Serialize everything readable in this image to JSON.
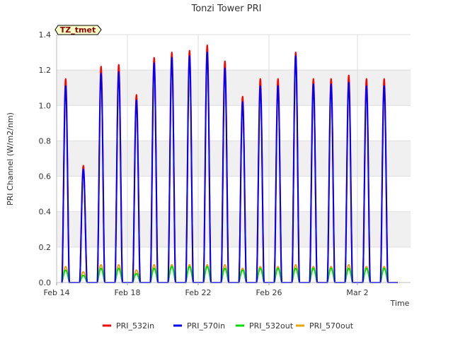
{
  "chart_data": {
    "type": "line",
    "title": "Tonzi Tower PRI",
    "xlabel": "Time",
    "ylabel": "PRI Channel (W/m2/nm)",
    "badge": "TZ_tmet",
    "x_start": "2024-02-14",
    "x_end": "2024-03-05",
    "xticks": [
      "Feb 14",
      "Feb 18",
      "Feb 22",
      "Feb 26",
      "Mar 2"
    ],
    "ylim": [
      0,
      1.4
    ],
    "yticks": [
      "0.0",
      "0.2",
      "0.4",
      "0.6",
      "0.8",
      "1.0",
      "1.2",
      "1.4"
    ],
    "grid": true,
    "legend_position": "bottom",
    "days": [
      "2024-02-14",
      "2024-02-15",
      "2024-02-16",
      "2024-02-17",
      "2024-02-18",
      "2024-02-19",
      "2024-02-20",
      "2024-02-21",
      "2024-02-22",
      "2024-02-23",
      "2024-02-24",
      "2024-02-25",
      "2024-02-26",
      "2024-02-27",
      "2024-02-28",
      "2024-02-29",
      "2024-03-01",
      "2024-03-02",
      "2024-03-03"
    ],
    "series": [
      {
        "name": "PRI_532in",
        "color": "#ff0000",
        "daily_peaks": [
          1.15,
          0.66,
          1.22,
          1.23,
          1.06,
          1.27,
          1.3,
          1.31,
          1.34,
          1.25,
          1.05,
          1.15,
          1.15,
          1.3,
          1.15,
          1.15,
          1.17,
          1.15,
          1.15
        ]
      },
      {
        "name": "PRI_570in",
        "color": "#0000ff",
        "daily_peaks": [
          1.11,
          0.64,
          1.18,
          1.19,
          1.03,
          1.24,
          1.27,
          1.28,
          1.3,
          1.21,
          1.02,
          1.11,
          1.11,
          1.28,
          1.12,
          1.12,
          1.13,
          1.11,
          1.11
        ]
      },
      {
        "name": "PRI_532out",
        "color": "#00dd00",
        "daily_peaks": [
          0.07,
          0.04,
          0.08,
          0.08,
          0.05,
          0.08,
          0.09,
          0.09,
          0.09,
          0.08,
          0.07,
          0.08,
          0.08,
          0.08,
          0.08,
          0.08,
          0.08,
          0.08,
          0.08
        ]
      },
      {
        "name": "PRI_570out",
        "color": "#e6a800",
        "daily_peaks": [
          0.09,
          0.06,
          0.1,
          0.1,
          0.07,
          0.1,
          0.1,
          0.1,
          0.1,
          0.1,
          0.08,
          0.09,
          0.09,
          0.1,
          0.09,
          0.09,
          0.1,
          0.09,
          0.09
        ]
      }
    ]
  }
}
